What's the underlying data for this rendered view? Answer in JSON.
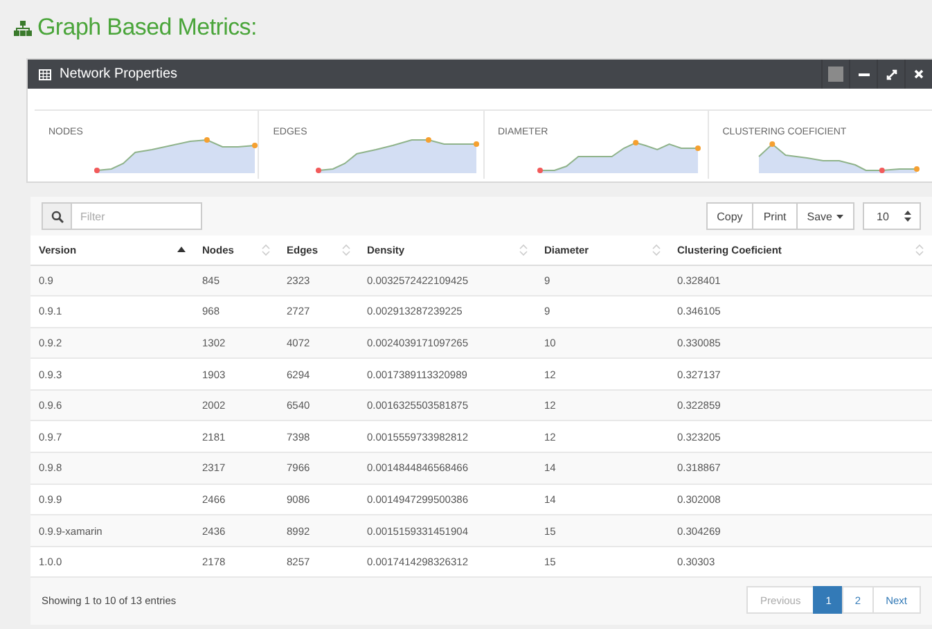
{
  "page_title": "Graph Based Metrics:",
  "panel": {
    "title": "Network Properties",
    "sparklines": [
      {
        "label": "NODES"
      },
      {
        "label": "EDGES"
      },
      {
        "label": "DIAMETER"
      },
      {
        "label": "CLUSTERING COEFICIENT"
      }
    ]
  },
  "table": {
    "filter": {
      "placeholder": "Filter"
    },
    "buttons": [
      {
        "label": "Copy",
        "dropdown": false
      },
      {
        "label": "Print",
        "dropdown": false
      },
      {
        "label": "Save",
        "dropdown": true
      }
    ],
    "page_size": "10",
    "columns": [
      {
        "label": "Version",
        "sorted": true
      },
      {
        "label": "Nodes",
        "sorted": false
      },
      {
        "label": "Edges",
        "sorted": false
      },
      {
        "label": "Density",
        "sorted": false
      },
      {
        "label": "Diameter",
        "sorted": false
      },
      {
        "label": "Clustering Coeficient",
        "sorted": false
      }
    ],
    "rows": [
      [
        "0.9",
        "845",
        "2323",
        "0.0032572422109425",
        "9",
        "0.328401"
      ],
      [
        "0.9.1",
        "968",
        "2727",
        "0.002913287239225",
        "9",
        "0.346105"
      ],
      [
        "0.9.2",
        "1302",
        "4072",
        "0.0024039171097265",
        "10",
        "0.330085"
      ],
      [
        "0.9.3",
        "1903",
        "6294",
        "0.0017389113320989",
        "12",
        "0.327137"
      ],
      [
        "0.9.6",
        "2002",
        "6540",
        "0.0016325503581875",
        "12",
        "0.322859"
      ],
      [
        "0.9.7",
        "2181",
        "7398",
        "0.0015559733982812",
        "12",
        "0.323205"
      ],
      [
        "0.9.8",
        "2317",
        "7966",
        "0.0014844846568466",
        "14",
        "0.318867"
      ],
      [
        "0.9.9",
        "2466",
        "9086",
        "0.0014947299500386",
        "14",
        "0.302008"
      ],
      [
        "0.9.9-xamarin",
        "2436",
        "8992",
        "0.0015159331451904",
        "15",
        "0.304269"
      ],
      [
        "1.0.0",
        "2178",
        "8257",
        "0.0017414298326312",
        "15",
        "0.30303"
      ]
    ],
    "info": "Showing 1 to 10 of 13 entries",
    "pagination": [
      {
        "label": "Previous",
        "kind": "prev",
        "disabled": true,
        "selected": false
      },
      {
        "label": "1",
        "kind": "page",
        "disabled": false,
        "selected": true
      },
      {
        "label": "2",
        "kind": "page",
        "disabled": false,
        "selected": false
      },
      {
        "label": "Next",
        "kind": "next",
        "disabled": false,
        "selected": false
      }
    ]
  }
}
